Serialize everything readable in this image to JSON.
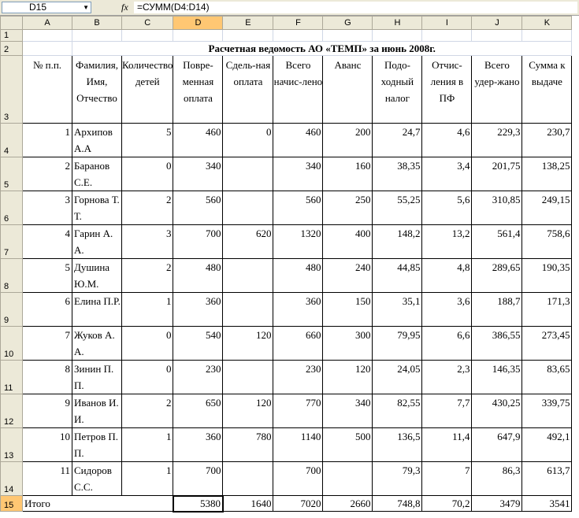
{
  "formula_bar": {
    "cell_ref": "D15",
    "fx_label": "fx",
    "formula": "=СУММ(D4:D14)"
  },
  "columns": [
    "A",
    "B",
    "C",
    "D",
    "E",
    "F",
    "G",
    "H",
    "I",
    "J",
    "K"
  ],
  "active_column": "D",
  "active_row": "15",
  "title": "Расчетная ведомость АО «ТЕМП» за июнь 2008г.",
  "headers": {
    "num": "№ п.п.",
    "name": "Фамилия, Имя, Отчество",
    "children": "Количество детей",
    "time_pay": "Повре-менная оплата",
    "piece_pay": "Сдель-ная оплата",
    "total": "Всего начис-лено",
    "advance": "Аванс",
    "tax": "Подо-ходный налог",
    "pf": "Отчис-ления в ПФ",
    "deducted": "Всего удер-жано",
    "payout": "Сумма к выдаче"
  },
  "rows": [
    {
      "rn": "4",
      "num": "1",
      "name": "Архипов А.А",
      "children": "5",
      "time_pay": "460",
      "piece_pay": "0",
      "total": "460",
      "advance": "200",
      "tax": "24,7",
      "pf": "4,6",
      "deducted": "229,3",
      "payout": "230,7"
    },
    {
      "rn": "5",
      "num": "2",
      "name": "Баранов С.Е.",
      "children": "0",
      "time_pay": "340",
      "piece_pay": "",
      "total": "340",
      "advance": "160",
      "tax": "38,35",
      "pf": "3,4",
      "deducted": "201,75",
      "payout": "138,25"
    },
    {
      "rn": "6",
      "num": "3",
      "name": "Горнова Т.Т.",
      "children": "2",
      "time_pay": "560",
      "piece_pay": "",
      "total": "560",
      "advance": "250",
      "tax": "55,25",
      "pf": "5,6",
      "deducted": "310,85",
      "payout": "249,15"
    },
    {
      "rn": "7",
      "num": "4",
      "name": "Гарин А.А.",
      "children": "3",
      "time_pay": "700",
      "piece_pay": "620",
      "total": "1320",
      "advance": "400",
      "tax": "148,2",
      "pf": "13,2",
      "deducted": "561,4",
      "payout": "758,6"
    },
    {
      "rn": "8",
      "num": "5",
      "name": "Душина Ю.М.",
      "children": "2",
      "time_pay": "480",
      "piece_pay": "",
      "total": "480",
      "advance": "240",
      "tax": "44,85",
      "pf": "4,8",
      "deducted": "289,65",
      "payout": "190,35"
    },
    {
      "rn": "9",
      "num": "6",
      "name": "Елина П.Р.",
      "children": "1",
      "time_pay": "360",
      "piece_pay": "",
      "total": "360",
      "advance": "150",
      "tax": "35,1",
      "pf": "3,6",
      "deducted": "188,7",
      "payout": "171,3"
    },
    {
      "rn": "10",
      "num": "7",
      "name": "Жуков А.А.",
      "children": "0",
      "time_pay": "540",
      "piece_pay": "120",
      "total": "660",
      "advance": "300",
      "tax": "79,95",
      "pf": "6,6",
      "deducted": "386,55",
      "payout": "273,45"
    },
    {
      "rn": "11",
      "num": "8",
      "name": "Зинин П.П.",
      "children": "0",
      "time_pay": "230",
      "piece_pay": "",
      "total": "230",
      "advance": "120",
      "tax": "24,05",
      "pf": "2,3",
      "deducted": "146,35",
      "payout": "83,65"
    },
    {
      "rn": "12",
      "num": "9",
      "name": "Иванов И.И.",
      "children": "2",
      "time_pay": "650",
      "piece_pay": "120",
      "total": "770",
      "advance": "340",
      "tax": "82,55",
      "pf": "7,7",
      "deducted": "430,25",
      "payout": "339,75"
    },
    {
      "rn": "13",
      "num": "10",
      "name": "Петров П.П.",
      "children": "1",
      "time_pay": "360",
      "piece_pay": "780",
      "total": "1140",
      "advance": "500",
      "tax": "136,5",
      "pf": "11,4",
      "deducted": "647,9",
      "payout": "492,1"
    },
    {
      "rn": "14",
      "num": "11",
      "name": "Сидоров С.С.",
      "children": "1",
      "time_pay": "700",
      "piece_pay": "",
      "total": "700",
      "advance": "",
      "tax": "79,3",
      "pf": "7",
      "deducted": "86,3",
      "payout": "613,7"
    }
  ],
  "totals": {
    "label": "Итого",
    "time_pay": "5380",
    "piece_pay": "1640",
    "total": "7020",
    "advance": "2660",
    "tax": "748,8",
    "pf": "70,2",
    "deducted": "3479",
    "payout": "3541"
  }
}
